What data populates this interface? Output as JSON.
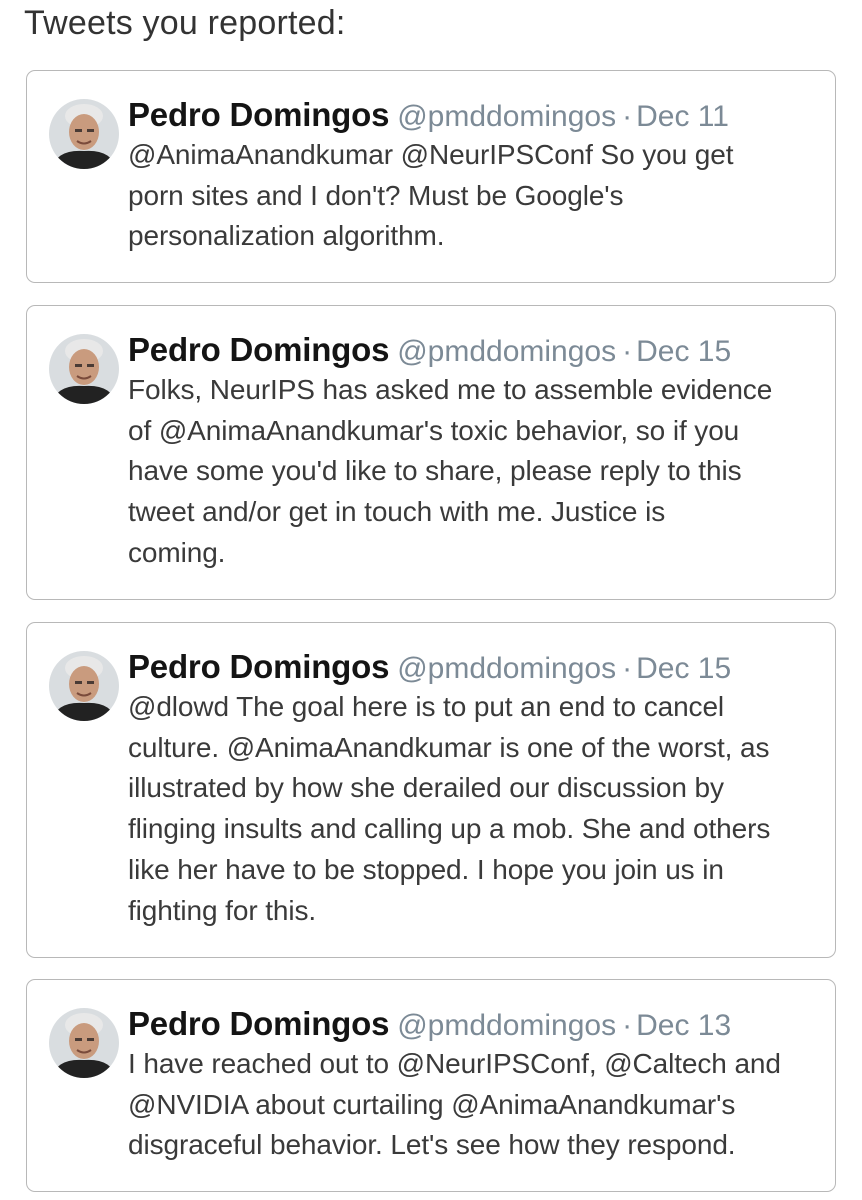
{
  "page": {
    "title": "Tweets you reported:"
  },
  "colors": {
    "card_border": "#b8b8b8",
    "handle_gray": "#7c8a96",
    "name_black": "#141414",
    "text": "#3a3a3a"
  },
  "tweets": [
    {
      "author_name": "Pedro Domingos",
      "handle": "@pmddomingos",
      "separator": "·",
      "date": "Dec 11",
      "avatar_icon": "profile-photo",
      "lines": [
        "@AnimaAnandkumar @NeurIPSConf So you get",
        "porn sites and I don't? Must be Google's",
        "personalization algorithm."
      ]
    },
    {
      "author_name": "Pedro Domingos",
      "handle": "@pmddomingos",
      "separator": "·",
      "date": "Dec 15",
      "avatar_icon": "profile-photo",
      "lines": [
        "Folks, NeurIPS has asked me to assemble evidence",
        "of @AnimaAnandkumar's toxic behavior, so if you",
        "have some you'd like to share, please reply to this",
        "tweet and/or get in touch with me. Justice is",
        "coming."
      ]
    },
    {
      "author_name": "Pedro Domingos",
      "handle": "@pmddomingos",
      "separator": "·",
      "date": "Dec 15",
      "avatar_icon": "profile-photo",
      "lines": [
        "@dlowd The goal here is to put an end to cancel",
        "culture. @AnimaAnandkumar  is one of the worst, as",
        "illustrated by how she derailed our discussion by",
        "flinging insults and calling up a mob. She and others",
        "like her have to be stopped. I hope you join us in",
        "fighting for this."
      ]
    },
    {
      "author_name": "Pedro Domingos",
      "handle": "@pmddomingos",
      "separator": "·",
      "date": "Dec 13",
      "avatar_icon": "profile-photo",
      "lines": [
        "I have reached out to @NeurIPSConf, @Caltech and",
        "@NVIDIA about curtailing @AnimaAnandkumar's",
        "disgraceful behavior. Let's see how they respond."
      ]
    }
  ]
}
